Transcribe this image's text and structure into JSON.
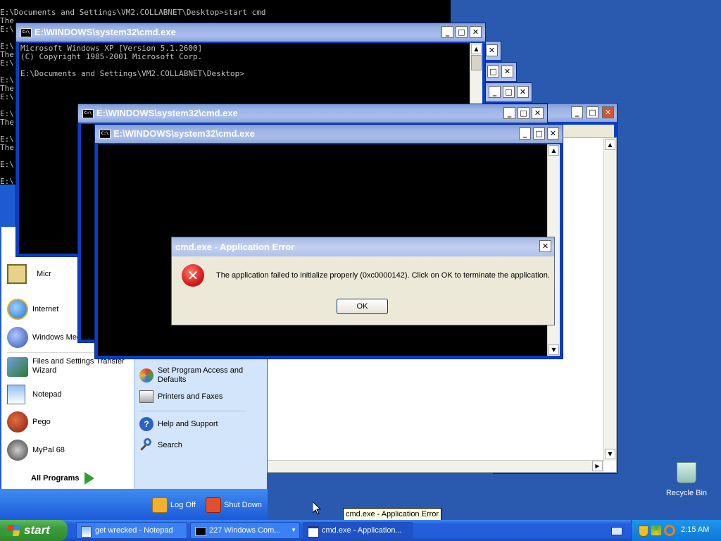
{
  "background_console": {
    "lines": [
      "E:\\Documents and Settings\\VM2.COLLABNET\\Desktop>start cmd",
      "The",
      "E:\\",
      "",
      "E:\\",
      "The",
      "E:\\",
      "",
      "E:\\",
      "The",
      "E:\\",
      "",
      "E:\\",
      "The",
      "",
      "E:\\",
      "The",
      "",
      "E:\\",
      "",
      "E:\\"
    ]
  },
  "cmd_main": {
    "title": "E:\\WINDOWS\\system32\\cmd.exe",
    "lines": [
      "Microsoft Windows XP [Version 5.1.2600]",
      "(C) Copyright 1985-2001 Microsoft Corp.",
      "",
      "E:\\Documents and Settings\\VM2.COLLABNET\\Desktop>"
    ]
  },
  "cmd_second": {
    "title": "E:\\WINDOWS\\system32\\cmd.exe"
  },
  "cmd_third": {
    "title": "E:\\WINDOWS\\system32\\cmd.exe"
  },
  "cmd_icon_text": "C:\\",
  "window_buttons": {
    "minimize": "_",
    "maximize": "□",
    "close": "✕"
  },
  "error_dialog": {
    "title": "cmd.exe - Application Error",
    "message": "The application failed to initialize properly (0xc0000142). Click on OK to terminate the application.",
    "ok_label": "OK"
  },
  "start_menu": {
    "pinned": [
      {
        "label": "Micr",
        "icon": "outlook-icon"
      },
      {
        "label": "Internet",
        "icon": "internet-explorer-icon"
      },
      {
        "label": "Windows Mec",
        "icon": "windows-media-player-icon"
      }
    ],
    "recent": [
      {
        "label": "Files and Settings Transfer Wizard",
        "icon": "transfer-wizard-icon"
      },
      {
        "label": "Notepad",
        "icon": "notepad-icon"
      },
      {
        "label": "Pego",
        "icon": "pego-icon"
      },
      {
        "label": "MyPal 68",
        "icon": "mypal-icon"
      }
    ],
    "all_programs": "All Programs",
    "right_items": [
      {
        "label": "Set Program Access and Defaults",
        "icon": "program-access-icon"
      },
      {
        "label": "Printers and Faxes",
        "icon": "printer-icon"
      },
      {
        "label": "Help and Support",
        "icon": "help-icon"
      },
      {
        "label": "Search",
        "icon": "search-icon"
      }
    ],
    "log_off": "Log Off",
    "shut_down": "Shut Down"
  },
  "tooltip": "cmd.exe - Application Error",
  "desktop": {
    "recycle_bin": "Recycle Bin"
  },
  "taskbar": {
    "start_label": "start",
    "buttons": [
      {
        "label": "get wrecked - Notepad",
        "icon": "notepad-icon"
      },
      {
        "label": "227 Windows Com...",
        "icon": "cmd-group-icon"
      },
      {
        "label": "cmd.exe - Application...",
        "icon": "window-icon"
      }
    ],
    "clock": "2:15 AM"
  },
  "colors": {
    "desktop": "#2a5ab0",
    "taskbar": "#245edb",
    "start_button": "#3c9a3c",
    "error_icon": "#d21f1f"
  }
}
